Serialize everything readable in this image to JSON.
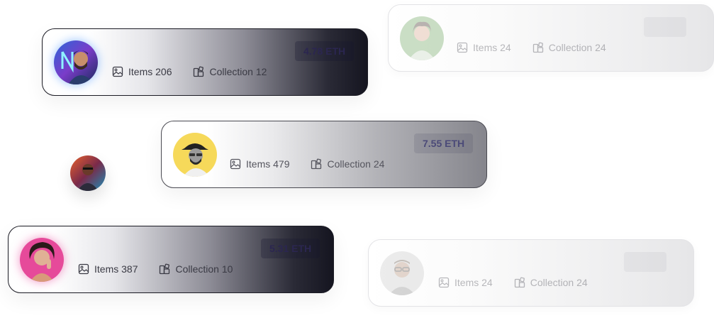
{
  "cards": [
    {
      "avatar": "avatar-neon-man",
      "price": "4.78 ETH",
      "items_label": "Items 206",
      "collection_label": "Collection 12",
      "icons": [
        "image-icon",
        "collection-icon"
      ]
    },
    {
      "avatar": "avatar-woman-green",
      "price": "",
      "items_label": "Items 24",
      "collection_label": "Collection 24",
      "icons": [
        "image-icon",
        "collection-icon"
      ]
    },
    {
      "avatar": "avatar-man-yellow-hat",
      "price": "7.55 ETH",
      "items_label": "Items 479",
      "collection_label": "Collection 24",
      "icons": [
        "image-icon",
        "collection-icon"
      ]
    },
    {
      "avatar": "avatar-woman-pink",
      "price": "5.31 ETH",
      "items_label": "Items 387",
      "collection_label": "Collection 10",
      "icons": [
        "image-icon",
        "collection-icon"
      ]
    },
    {
      "avatar": "avatar-man-glasses",
      "price": "",
      "items_label": "Items 24",
      "collection_label": "Collection 24",
      "icons": [
        "image-icon",
        "collection-icon"
      ]
    }
  ],
  "loose_avatar": "avatar-neon-city-man",
  "colors": {
    "price_text": "#2b2650",
    "label_text": "#3a3a44",
    "dark_border": "#1b1b24"
  }
}
